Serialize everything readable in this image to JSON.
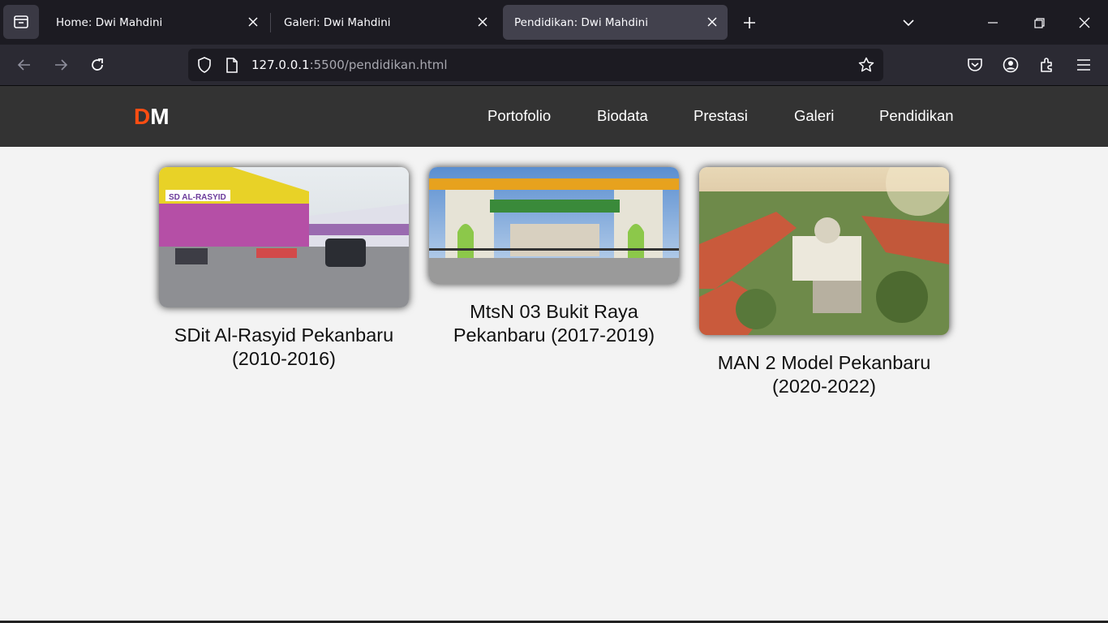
{
  "browser": {
    "tabs": [
      {
        "title": "Home: Dwi Mahdini",
        "active": false
      },
      {
        "title": "Galeri: Dwi Mahdini",
        "active": false
      },
      {
        "title": "Pendidikan: Dwi Mahdini",
        "active": true
      }
    ],
    "url_host": "127.0.0.1",
    "url_rest": ":5500/pendidikan.html"
  },
  "site": {
    "logo_d": "D",
    "logo_m": "M",
    "nav": [
      "Portofolio",
      "Biodata",
      "Prestasi",
      "Galeri",
      "Pendidikan"
    ],
    "schools": [
      {
        "name_line1": "SDit Al-Rasyid Pekanbaru",
        "name_line2": "(2010-2016)"
      },
      {
        "name_line1": "MtsN 03 Bukit Raya",
        "name_line2": "Pekanbaru (2017-2019)"
      },
      {
        "name_line1": "MAN 2 Model Pekanbaru",
        "name_line2": "(2020-2022)"
      }
    ]
  },
  "colors": {
    "accent": "#ff4d12",
    "header_bg": "#333333",
    "page_bg": "#f3f3f3"
  }
}
